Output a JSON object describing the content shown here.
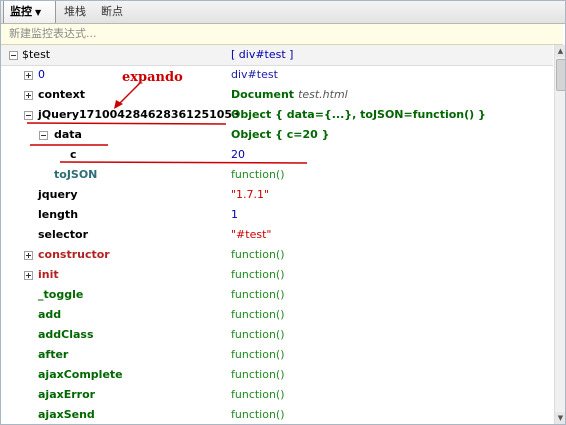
{
  "tabs": [
    {
      "label": "监控",
      "active": true,
      "has_dropdown": true
    },
    {
      "label": "堆栈",
      "active": false
    },
    {
      "label": "断点",
      "active": false
    }
  ],
  "watch_input": {
    "placeholder": "新建监控表达式..."
  },
  "rows": [
    {
      "name": "$test",
      "value": "[ div#test ]",
      "toggle": "minus",
      "name_style": "plain",
      "value_style": "blue",
      "header": true
    },
    {
      "name": "0",
      "value": "div#test",
      "toggle": "plus",
      "name_style": "blue",
      "value_style": "navy"
    },
    {
      "name": "context",
      "value_main": "Document",
      "value_extra": "test.html",
      "toggle": "plus",
      "name_style": "black",
      "value_style": "green"
    },
    {
      "name": "jQuery171004284628361251053",
      "value": "Object { data={...}, toJSON=function() }",
      "toggle": "minus",
      "name_style": "black",
      "value_style": "green"
    },
    {
      "name": "data",
      "value": "Object { c=20 }",
      "toggle": "minus",
      "name_style": "black",
      "value_style": "green"
    },
    {
      "name": "c",
      "value": "20",
      "toggle": "none",
      "name_style": "black",
      "value_style": "blue"
    },
    {
      "name": "toJSON",
      "value": "function()",
      "toggle": "none",
      "name_style": "teal",
      "value_style": "dkgreen"
    },
    {
      "name": "jquery",
      "value": "\"1.7.1\"",
      "toggle": "none",
      "name_style": "black",
      "value_style": "red"
    },
    {
      "name": "length",
      "value": "1",
      "toggle": "none",
      "name_style": "black",
      "value_style": "blue"
    },
    {
      "name": "selector",
      "value": "\"#test\"",
      "toggle": "none",
      "name_style": "black",
      "value_style": "red"
    },
    {
      "name": "constructor",
      "value": "function()",
      "toggle": "plus",
      "name_style": "darkred",
      "value_style": "dkgreen"
    },
    {
      "name": "init",
      "value": "function()",
      "toggle": "plus",
      "name_style": "darkred",
      "value_style": "dkgreen"
    },
    {
      "name": "_toggle",
      "value": "function()",
      "toggle": "none",
      "name_style": "green",
      "value_style": "dkgreen"
    },
    {
      "name": "add",
      "value": "function()",
      "toggle": "none",
      "name_style": "green",
      "value_style": "dkgreen"
    },
    {
      "name": "addClass",
      "value": "function()",
      "toggle": "none",
      "name_style": "green",
      "value_style": "dkgreen"
    },
    {
      "name": "after",
      "value": "function()",
      "toggle": "none",
      "name_style": "green",
      "value_style": "dkgreen"
    },
    {
      "name": "ajaxComplete",
      "value": "function()",
      "toggle": "none",
      "name_style": "green",
      "value_style": "dkgreen"
    },
    {
      "name": "ajaxError",
      "value": "function()",
      "toggle": "none",
      "name_style": "green",
      "value_style": "dkgreen"
    },
    {
      "name": "ajaxSend",
      "value": "function()",
      "toggle": "none",
      "name_style": "green",
      "value_style": "dkgreen"
    }
  ],
  "annotation": {
    "text": "expando",
    "color": "#cc0000"
  }
}
